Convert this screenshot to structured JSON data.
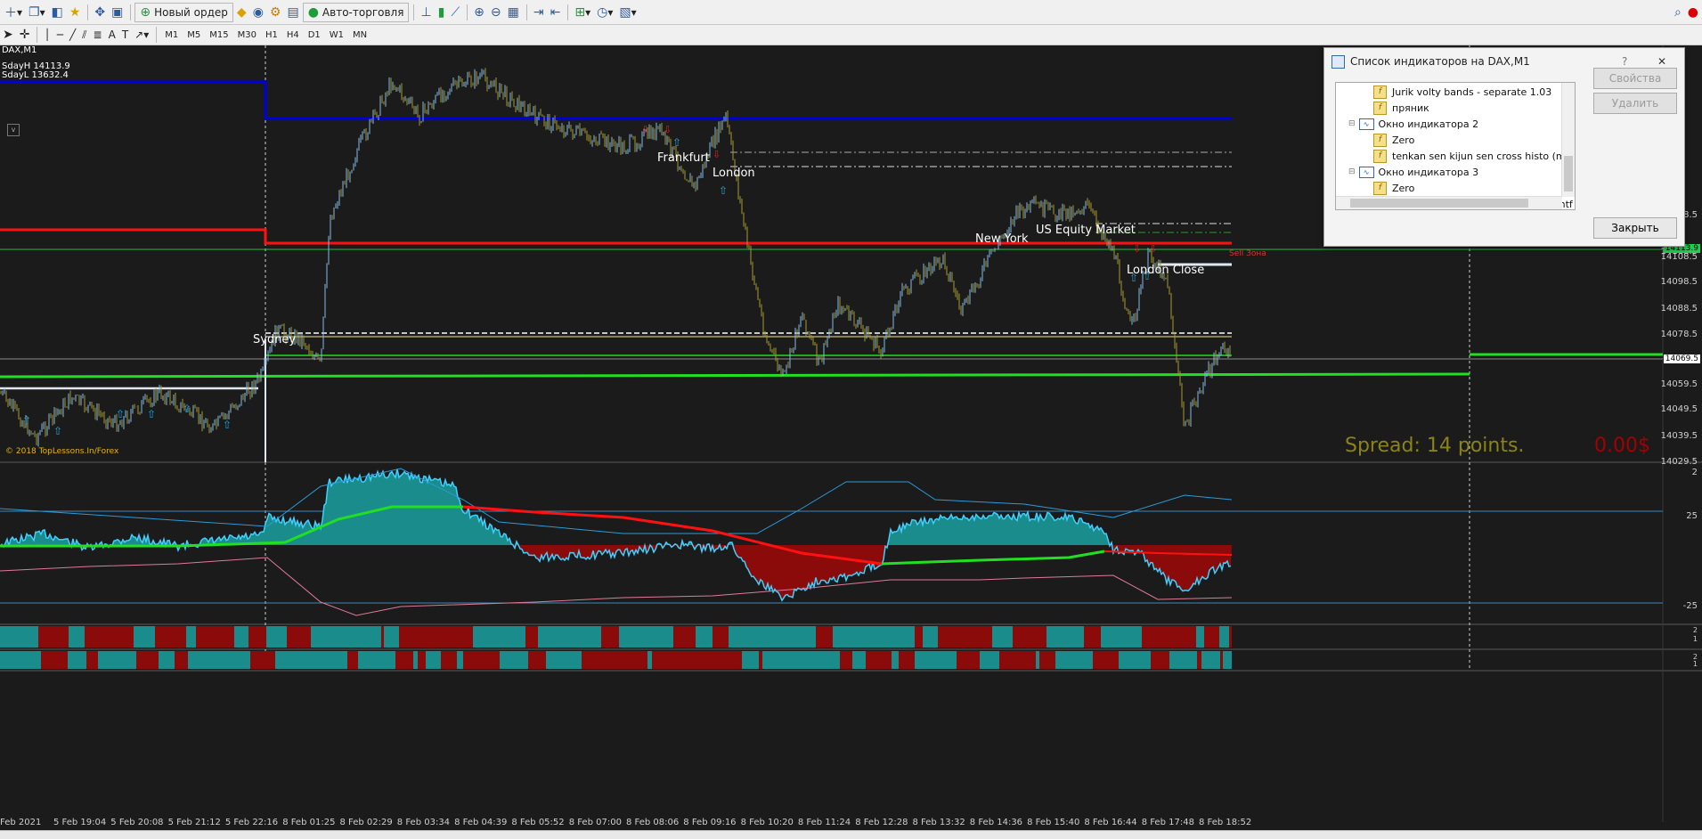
{
  "toolbar": {
    "new_order": "Новый ордер",
    "auto_trading": "Авто-торговля"
  },
  "timeframes": [
    "M1",
    "M5",
    "M15",
    "M30",
    "H1",
    "H4",
    "D1",
    "W1",
    "MN"
  ],
  "chart": {
    "symbol_title": "DAX,M1",
    "sday_high": "SdayH 14113.9",
    "sday_low": "SdayL 13632.4",
    "copyright": "© 2018 TopLessons.In/Forex",
    "spread_text": "Spread: 14 points.",
    "profit_text": "0.00$",
    "sell_zone": "Sell Зона",
    "current_price": "14069.5",
    "level_price": "14113.9",
    "sessions": {
      "sydney": "Sydney",
      "frankfurt": "Frankfurt",
      "london": "London",
      "new_york": "New York",
      "us_equity": "US Equity Market",
      "london_close": "London Close"
    },
    "price_ticks": [
      "14128.5",
      "14118.5",
      "14108.5",
      "14098.5",
      "14088.5",
      "14078.5",
      "14059.5",
      "14049.5",
      "14039.5",
      "14029.5"
    ],
    "osc_ticks": [
      "2",
      "25",
      "-25"
    ],
    "bar_ticks": [
      "2",
      "1",
      "2",
      "1"
    ],
    "time_ticks": [
      "Feb 2021",
      "5 Feb 19:04",
      "5 Feb 20:08",
      "5 Feb 21:12",
      "5 Feb 22:16",
      "8 Feb 01:25",
      "8 Feb 02:29",
      "8 Feb 03:34",
      "8 Feb 04:39",
      "8 Feb 05:52",
      "8 Feb 07:00",
      "8 Feb 08:06",
      "8 Feb 09:16",
      "8 Feb 10:20",
      "8 Feb 11:24",
      "8 Feb 12:28",
      "8 Feb 13:32",
      "8 Feb 14:36",
      "8 Feb 15:40",
      "8 Feb 16:44",
      "8 Feb 17:48",
      "8 Feb 18:52"
    ],
    "colors": {
      "up": "#86b9e6",
      "down": "#a59a31",
      "teal": "#1b8c8c",
      "darkred": "#8b0a0a"
    }
  },
  "dialog": {
    "title": "Список индикаторов на DAX,M1",
    "help": "?",
    "close_x": "✕",
    "rows": [
      {
        "label": "Jurik volty bands - separate 1.03",
        "type": "indicator"
      },
      {
        "label": "пряник",
        "type": "indicator"
      },
      {
        "label": "Окно индикатора 2",
        "type": "window"
      },
      {
        "label": "Zero",
        "type": "indicator"
      },
      {
        "label": "tenkan sen kijun sen cross histo (mtf + ale",
        "type": "indicator"
      },
      {
        "label": "Окно индикатора 3",
        "type": "window"
      },
      {
        "label": "Zero",
        "type": "indicator"
      },
      {
        "label": "tenkan sen kijun sen cross histo (mtf + ale",
        "type": "indicator"
      }
    ],
    "buttons": {
      "properties": "Свойства",
      "delete": "Удалить",
      "close": "Закрыть"
    }
  }
}
